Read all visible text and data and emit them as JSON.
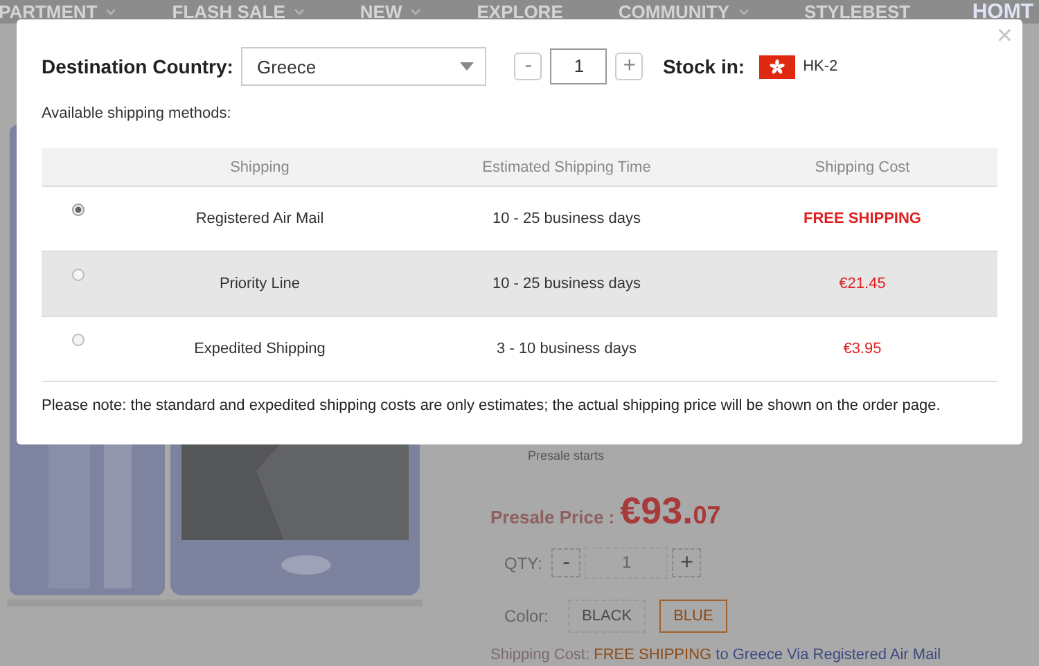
{
  "nav": {
    "items": [
      {
        "label": "PARTMENT",
        "has_menu": true
      },
      {
        "label": "FLASH SALE",
        "has_menu": true
      },
      {
        "label": "NEW",
        "has_menu": true
      },
      {
        "label": "EXPLORE",
        "has_menu": false
      },
      {
        "label": "COMMUNITY",
        "has_menu": true
      },
      {
        "label": "STYLEBEST",
        "has_menu": false
      }
    ],
    "logo": "HOMT"
  },
  "product": {
    "presale_starts": "Presale starts",
    "price_label": "Presale Price :",
    "price_main": "€93.",
    "price_cents": "07",
    "qty_label": "QTY:",
    "qty_minus": "-",
    "qty": "1",
    "qty_plus": "+",
    "color_label": "Color:",
    "colors": [
      {
        "label": "BLACK",
        "selected": false
      },
      {
        "label": "BLUE",
        "selected": true
      }
    ],
    "shipping_line": {
      "label": "Shipping Cost:",
      "highlight": "FREE SHIPPING",
      "rest": "to Greece Via Registered Air Mail"
    }
  },
  "modal": {
    "close": "×",
    "destination_label": "Destination Country:",
    "country": "Greece",
    "qty_minus": "-",
    "qty": "1",
    "qty_plus": "+",
    "stock_label": "Stock in:",
    "warehouse": "HK-2",
    "available_label": "Available shipping methods:",
    "table": {
      "columns": [
        "Shipping",
        "Estimated Shipping Time",
        "Shipping Cost"
      ],
      "rows": [
        {
          "selected": true,
          "highlighted": false,
          "shipping": "Registered Air Mail",
          "time": "10 - 25 business days",
          "cost": "FREE SHIPPING",
          "free": true
        },
        {
          "selected": false,
          "highlighted": true,
          "shipping": "Priority Line",
          "time": "10 - 25 business days",
          "cost": "€21.45",
          "free": false
        },
        {
          "selected": false,
          "highlighted": false,
          "shipping": "Expedited Shipping",
          "time": "3 - 10 business days",
          "cost": "€3.95",
          "free": false
        }
      ]
    },
    "note": "Please note: the standard and expedited shipping costs are only estimates; the actual shipping price will be shown on the order page."
  }
}
